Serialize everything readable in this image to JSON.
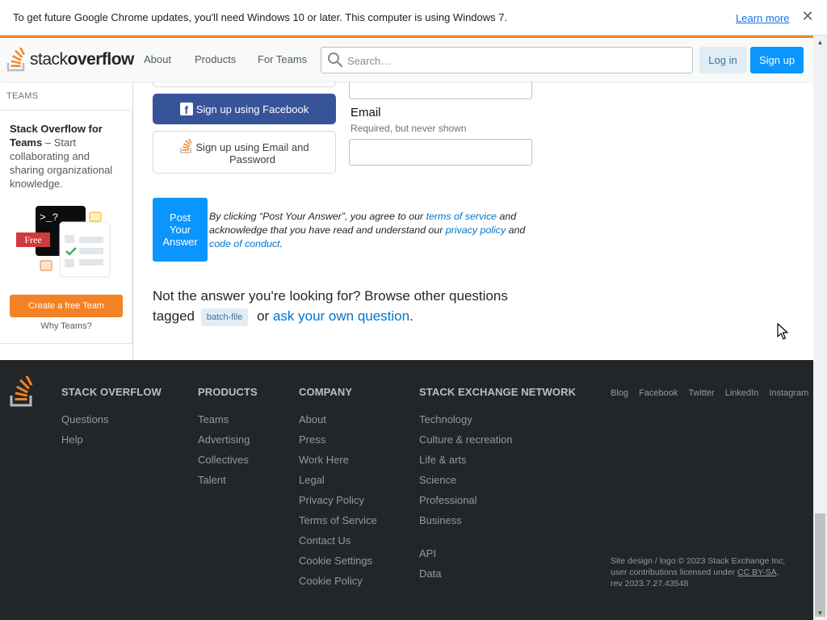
{
  "browser": {
    "infobar": {
      "message": "To get future Google Chrome updates, you'll need Windows 10 or later. This computer is using Windows 7.",
      "learn_more": "Learn more",
      "close": "✕"
    }
  },
  "header": {
    "logo_prefix": "stack",
    "logo_bold": "overflow",
    "nav": [
      "About",
      "Products",
      "For Teams"
    ],
    "search_placeholder": "Search…",
    "login": "Log in",
    "signup": "Sign up",
    "accent_color": "#f48225"
  },
  "sidebar": {
    "heading": "TEAMS",
    "card_title": "Stack Overflow for Teams",
    "card_text": " – Start collaborating and sharing organizational knowledge.",
    "badge": "Free",
    "prompt": ">_?",
    "cta": "Create a free Team",
    "why": "Why Teams?"
  },
  "signup": {
    "facebook": "Sign up using Facebook",
    "email_password": "Sign up using Email and Password",
    "email_label": "Email",
    "email_help": "Required, but never shown"
  },
  "post": {
    "button": "Post Your Answer",
    "legal_1": "By clicking “Post Your Answer”, you agree to our ",
    "terms_link": "terms of service",
    "legal_2": " and acknowledge that you have read and understand our ",
    "privacy_link": "privacy policy",
    "legal_3": " and ",
    "conduct_link": "code of conduct",
    "legal_4": "."
  },
  "browse": {
    "text_1": "Not the answer you're looking for? Browse other questions tagged ",
    "tag": "batch-file",
    "text_2": " or ",
    "ask_link": "ask your own question",
    "text_3": "."
  },
  "footer": {
    "columns": [
      {
        "title": "STACK OVERFLOW",
        "links": [
          "Questions",
          "Help"
        ]
      },
      {
        "title": "PRODUCTS",
        "links": [
          "Teams",
          "Advertising",
          "Collectives",
          "Talent"
        ]
      },
      {
        "title": "COMPANY",
        "links": [
          "About",
          "Press",
          "Work Here",
          "Legal",
          "Privacy Policy",
          "Terms of Service",
          "Contact Us",
          "Cookie Settings",
          "Cookie Policy"
        ]
      },
      {
        "title": "STACK EXCHANGE NETWORK",
        "links": [
          "Technology",
          "Culture & recreation",
          "Life & arts",
          "Science",
          "Professional",
          "Business"
        ],
        "extra_links": [
          "API",
          "Data"
        ]
      }
    ],
    "social": [
      "Blog",
      "Facebook",
      "Twitter",
      "LinkedIn",
      "Instagram"
    ],
    "copyright_1": "Site design / logo © 2023 Stack Exchange Inc;",
    "copyright_2": "user contributions licensed under ",
    "license_link": "CC BY-SA",
    "copyright_3": ".",
    "revision": "rev 2023.7.27.43548"
  }
}
